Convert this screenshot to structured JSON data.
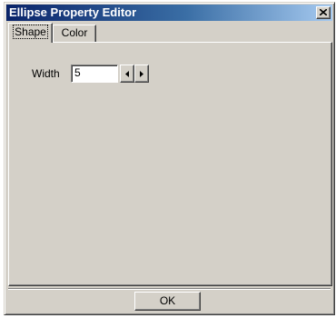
{
  "window": {
    "title": "Ellipse Property Editor"
  },
  "tabs": [
    {
      "label": "Shape",
      "selected": true
    },
    {
      "label": "Color",
      "selected": false
    }
  ],
  "shape": {
    "width_label": "Width",
    "width_value": "5"
  },
  "icons": {
    "close": "close-icon",
    "spin_left": "left-arrow-icon",
    "spin_right": "right-arrow-icon"
  },
  "footer": {
    "ok_label": "OK"
  },
  "colors": {
    "titlebar_start": "#0a246a",
    "titlebar_end": "#a6caf0",
    "face": "#d4d0c8"
  }
}
